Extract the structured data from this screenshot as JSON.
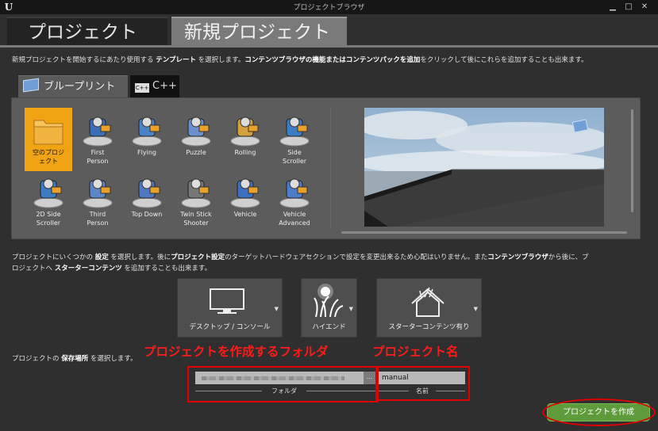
{
  "window": {
    "title": "プロジェクトブラウザ"
  },
  "tabs": [
    {
      "label": "プロジェクト"
    },
    {
      "label": "新規プロジェクト"
    }
  ],
  "intro": {
    "p1": "新規プロジェクトを開始するにあたり使用する ",
    "b1": "テンプレート",
    "p2": " を選択します。",
    "b2": "コンテンツブラウザの機能またはコンテンツパックを追加",
    "p3": "をクリックして後にこれらを追加することも出来ます。"
  },
  "template_tabs": [
    {
      "label": "ブループリント"
    },
    {
      "label": "C++"
    }
  ],
  "templates": [
    {
      "label": "空のプロジ\nェクト",
      "icon": "folder-icon",
      "selected": true
    },
    {
      "label": "First\nPerson",
      "icon": "first-person-icon"
    },
    {
      "label": "Flying",
      "icon": "flying-icon"
    },
    {
      "label": "Puzzle",
      "icon": "puzzle-icon"
    },
    {
      "label": "Rolling",
      "icon": "rolling-icon"
    },
    {
      "label": "Side\nScroller",
      "icon": "side-scroller-icon"
    },
    {
      "label": "2D Side\nScroller",
      "icon": "2d-side-scroller-icon"
    },
    {
      "label": "Third\nPerson",
      "icon": "third-person-icon"
    },
    {
      "label": "Top Down",
      "icon": "top-down-icon"
    },
    {
      "label": "Twin Stick\nShooter",
      "icon": "twin-stick-shooter-icon"
    },
    {
      "label": "Vehicle",
      "icon": "vehicle-icon"
    },
    {
      "label": "Vehicle\nAdvanced",
      "icon": "vehicle-advanced-icon"
    }
  ],
  "settings_desc": {
    "line1_a": "プロジェクトにいくつかの ",
    "line1_b": "設定",
    "line1_c": " を選択します。後に",
    "line1_d": "プロジェクト設定",
    "line1_e": "のターゲットハードウェアセクションで設定を変更出来るため心配はいりません。また",
    "line1_f": "コンテンツブラウザ",
    "line1_g": "から後に、プ",
    "line2_a": "ロジェクトへ ",
    "line2_b": "スターターコンテンツ",
    "line2_c": " を追加することも出来ます。"
  },
  "settings": [
    {
      "label": "デスクトップ / コンソール",
      "icon": "monitor-icon"
    },
    {
      "label": "ハイエンド",
      "icon": "sun-grass-icon"
    },
    {
      "label": "スターターコンテンツ有り",
      "icon": "starter-content-icon"
    }
  ],
  "location": {
    "desc_a": "プロジェクトの ",
    "desc_b": "保存場所",
    "desc_c": " を選択します。",
    "folder_label": "フォルダ",
    "name_label": "名前",
    "name_value": "manual",
    "browse": "..."
  },
  "annotations": {
    "folder": "プロジェクトを作成するフォルダ",
    "name": "プロジェクト名"
  },
  "create_button": "プロジェクトを作成",
  "colors": {
    "selected": "#f0a414",
    "create": "#5e9b3a",
    "annotation": "#ff1a1a"
  }
}
